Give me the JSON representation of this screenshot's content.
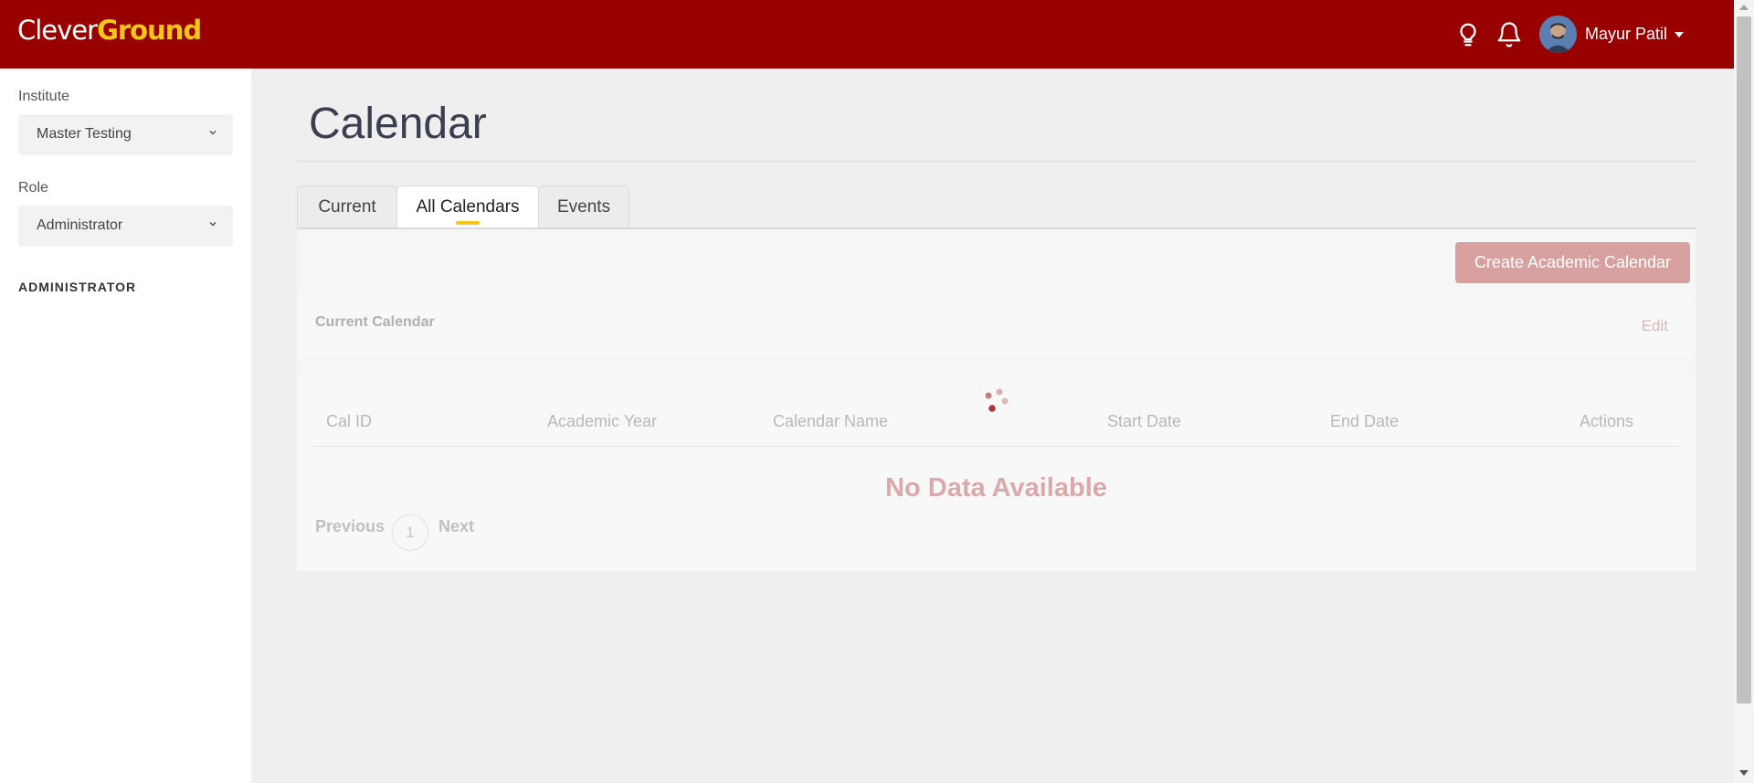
{
  "header": {
    "logo_part1": "Clever",
    "logo_part2": "Ground",
    "user_name": "Mayur Patil",
    "icons": [
      "lightbulb-icon",
      "bell-icon",
      "avatar"
    ],
    "colors": {
      "brand": "#990000",
      "logo_accent": "#f5c518"
    }
  },
  "sidebar": {
    "institute_label": "Institute",
    "institute_value": "Master Testing",
    "role_label": "Role",
    "role_value": "Administrator",
    "section_title": "ADMINISTRATOR"
  },
  "main": {
    "title": "Calendar",
    "tabs": [
      {
        "label": "Current",
        "active": false
      },
      {
        "label": "All Calendars",
        "active": true
      },
      {
        "label": "Events",
        "active": false
      }
    ],
    "create_button": "Create Academic Calendar",
    "current_calendar": {
      "title": "Current Calendar",
      "edit_label": "Edit"
    },
    "table": {
      "columns": [
        "Cal ID",
        "Academic Year",
        "Calendar Name",
        "Start Date",
        "End Date",
        "Actions"
      ],
      "rows": [],
      "empty_message": "No Data Available",
      "pagination": {
        "previous": "Previous",
        "page": "1",
        "next": "Next"
      }
    }
  }
}
